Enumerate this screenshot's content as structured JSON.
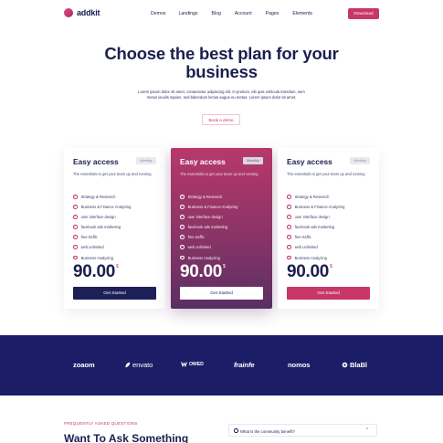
{
  "nav": {
    "logo": "addkit",
    "menu": [
      "Demos",
      "Landings",
      "Blog",
      "Account",
      "Pages",
      "Elements"
    ],
    "download": "Download"
  },
  "hero": {
    "title": "Choose the best plan for your business",
    "description": "Lorem ipsum dolor sit amet, consectetur adipiscing elit. In pretium, elit quis vehicula interdum, sem metus iaculis sapien, sed bibendum lectus augue eu metus. Lorem ipsum dolor sit amet.",
    "button": "Book a demo"
  },
  "plans": [
    {
      "name": "Easy access",
      "badge": "Monthly",
      "subtitle": "The essentials to get your team up and running",
      "features": [
        "Strategy & Research",
        "Business & Finance Analyzing",
        "user interface design",
        "facebook ads marketing",
        "free traffic",
        "web unlimited",
        "Business Analyzing"
      ],
      "price": "90.00",
      "currency": "$",
      "cta": "Get Started"
    },
    {
      "name": "Easy access",
      "badge": "Monthly",
      "subtitle": "The essentials to get your team up and running",
      "features": [
        "Strategy & Research",
        "Business & Finance Analyzing",
        "user interface design",
        "facebook ads marketing",
        "free traffic",
        "web unlimited",
        "Business Analyzing"
      ],
      "price": "90.00",
      "currency": "$",
      "cta": "Get Started"
    },
    {
      "name": "Easy access",
      "badge": "Monthly",
      "subtitle": "The essentials to get your team up and running",
      "features": [
        "Strategy & Research",
        "Business & Finance Analyzing",
        "user interface design",
        "facebook ads marketing",
        "free traffic",
        "web unlimited",
        "Business Analyzing"
      ],
      "price": "90.00",
      "currency": "$",
      "cta": "Get Started"
    }
  ],
  "brands": [
    "zoaom",
    "envato",
    "OWED",
    "frainfe",
    "nomos",
    "BlaBl"
  ],
  "faq": {
    "kicker": "FREQUENTLY ASKED QUESTIONS",
    "title": "Want To Ask Something",
    "first_question": "What is the community benefit?"
  },
  "colors": {
    "accent": "#c8366a",
    "navy": "#1b1f4f",
    "band": "#1b1e66"
  }
}
